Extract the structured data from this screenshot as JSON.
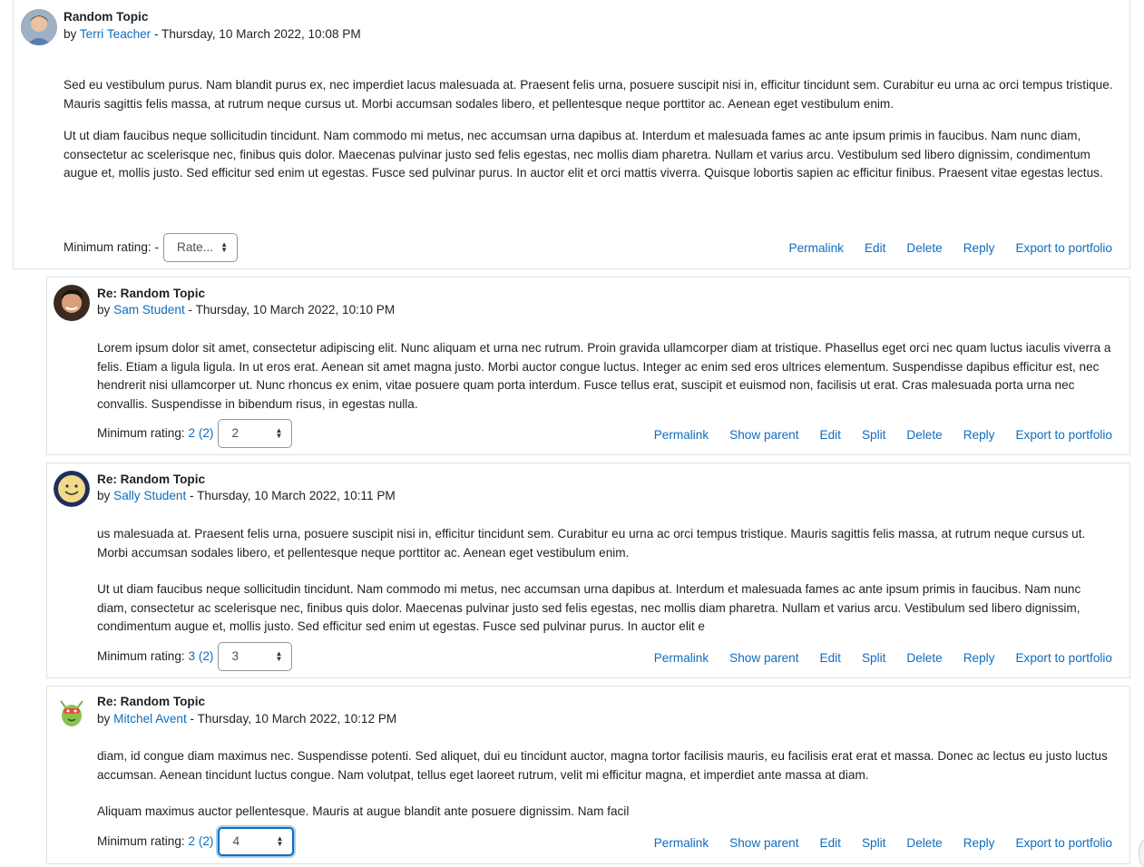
{
  "posts": [
    {
      "subject": "Random Topic",
      "by": "by",
      "author": "Terri Teacher",
      "date": " - Thursday, 10 March 2022, 10:08 PM",
      "paragraphs": [
        "Sed eu vestibulum purus. Nam blandit purus ex, nec imperdiet lacus malesuada at. Praesent felis urna, posuere suscipit nisi in, efficitur tincidunt sem. Curabitur eu urna ac orci tempus tristique. Mauris sagittis felis massa, at rutrum neque cursus ut. Morbi accumsan sodales libero, et pellentesque neque porttitor ac. Aenean eget vestibulum enim.",
        "Ut ut diam faucibus neque sollicitudin tincidunt. Nam commodo mi metus, nec accumsan urna dapibus at. Interdum et malesuada fames ac ante ipsum primis in faucibus. Nam nunc diam, consectetur ac scelerisque nec, finibus quis dolor. Maecenas pulvinar justo sed felis egestas, nec mollis diam pharetra. Nullam et varius arcu. Vestibulum sed libero dignissim, condimentum augue et, mollis justo. Sed efficitur sed enim ut egestas. Fusce sed pulvinar purus. In auctor elit et orci mattis viverra. Quisque lobortis sapien ac efficitur finibus. Praesent vitae egestas lectus."
      ],
      "rating_label": "Minimum rating:",
      "rating_value": "-",
      "rating_count": "",
      "select_value": "Rate...",
      "actions": [
        "Permalink",
        "Edit",
        "Delete",
        "Reply",
        "Export to portfolio"
      ]
    },
    {
      "subject": "Re: Random Topic",
      "by": "by",
      "author": "Sam Student",
      "date": " - Thursday, 10 March 2022, 10:10 PM",
      "paragraphs": [
        "Lorem ipsum dolor sit amet, consectetur adipiscing elit. Nunc aliquam et urna nec rutrum. Proin gravida ullamcorper diam at tristique. Phasellus eget orci nec quam luctus iaculis viverra a felis. Etiam a ligula ligula. In ut eros erat. Aenean sit amet magna justo. Morbi auctor congue luctus. Integer ac enim sed eros ultrices elementum. Suspendisse dapibus efficitur est, nec hendrerit nisi ullamcorper ut. Nunc rhoncus ex enim, vitae posuere quam porta interdum. Fusce tellus erat, suscipit et euismod non, facilisis ut erat. Cras malesuada porta urna nec convallis. Suspendisse in bibendum risus, in egestas nulla."
      ],
      "rating_label": "Minimum rating:",
      "rating_value": "2",
      "rating_count": "(2)",
      "select_value": "2",
      "actions": [
        "Permalink",
        "Show parent",
        "Edit",
        "Split",
        "Delete",
        "Reply",
        "Export to portfolio"
      ]
    },
    {
      "subject": "Re: Random Topic",
      "by": "by",
      "author": "Sally Student",
      "date": " - Thursday, 10 March 2022, 10:11 PM",
      "paragraphs": [
        "us malesuada at. Praesent felis urna, posuere suscipit nisi in, efficitur tincidunt sem. Curabitur eu urna ac orci tempus tristique. Mauris sagittis felis massa, at rutrum neque cursus ut. Morbi accumsan sodales libero, et pellentesque neque porttitor ac. Aenean eget vestibulum enim.",
        "Ut ut diam faucibus neque sollicitudin tincidunt. Nam commodo mi metus, nec accumsan urna dapibus at. Interdum et malesuada fames ac ante ipsum primis in faucibus. Nam nunc diam, consectetur ac scelerisque nec, finibus quis dolor. Maecenas pulvinar justo sed felis egestas, nec mollis diam pharetra. Nullam et varius arcu. Vestibulum sed libero dignissim, condimentum augue et, mollis justo. Sed efficitur sed enim ut egestas. Fusce sed pulvinar purus. In auctor elit e"
      ],
      "rating_label": "Minimum rating:",
      "rating_value": "3",
      "rating_count": "(2)",
      "select_value": "3",
      "actions": [
        "Permalink",
        "Show parent",
        "Edit",
        "Split",
        "Delete",
        "Reply",
        "Export to portfolio"
      ]
    },
    {
      "subject": "Re: Random Topic",
      "by": "by",
      "author": "Mitchel Avent",
      "date": " - Thursday, 10 March 2022, 10:12 PM",
      "paragraphs": [
        "diam, id congue diam maximus nec. Suspendisse potenti. Sed aliquet, dui eu tincidunt auctor, magna tortor facilisis mauris, eu facilisis erat erat et massa. Donec ac lectus eu justo luctus accumsan. Aenean tincidunt luctus congue. Nam volutpat, tellus eget laoreet rutrum, velit mi efficitur magna, et imperdiet ante massa at diam.",
        "Aliquam maximus auctor pellentesque. Mauris at augue blandit ante posuere dignissim. Nam facil"
      ],
      "rating_label": "Minimum rating:",
      "rating_value": "2",
      "rating_count": "(2)",
      "select_value": "4",
      "actions": [
        "Permalink",
        "Show parent",
        "Edit",
        "Split",
        "Delete",
        "Reply",
        "Export to portfolio"
      ]
    }
  ],
  "colors": {
    "link": "#0f6cbf",
    "border": "#dee2e6",
    "text": "#1d2125"
  }
}
